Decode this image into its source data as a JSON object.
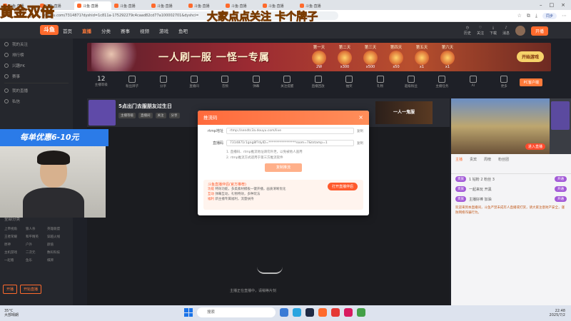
{
  "overlay": {
    "top_left": "黄金双倍",
    "top_center": "大家点点关注 卡个牌子",
    "cam_banner": "每单优惠6-10元"
  },
  "browser": {
    "tabs": [
      "斗鱼·直播",
      "斗鱼·直播",
      "斗鱼·直播",
      "斗鱼·直播",
      "斗鱼·直播",
      "斗鱼·直播",
      "斗鱼·直播",
      "斗鱼·直播",
      "斗鱼·直播"
    ],
    "url": "douyu.com/7314871?dyshid=1c811a-175292279c4caad82cd77a100002701&dyshci=",
    "sync_label": "同步"
  },
  "site": {
    "logo": "斗鱼",
    "nav": [
      "首页",
      "直播",
      "分类",
      "赛事",
      "视频",
      "游戏",
      "鱼吧"
    ],
    "nav_active_index": 1,
    "header_icons": [
      "历史",
      "关注",
      "下载",
      "消息"
    ],
    "open_live": "开播"
  },
  "sidebar": {
    "items": [
      "我的关注",
      "排行榜",
      "兴趣PK",
      "赛事",
      "我的直播",
      "私信"
    ],
    "grid": [
      "上帝视角",
      "狼人杀",
      "英雄联盟",
      "王者荣耀",
      "和平精英",
      "穿越火线",
      "原神",
      "户外",
      "颜值",
      "主机游戏",
      "二次元",
      "数码科技",
      "一起看",
      "鱼乐",
      "棋牌"
    ],
    "section_title": "全部分类",
    "foot_buttons": [
      "开播",
      "开始直播"
    ]
  },
  "banner": {
    "slogan": "一人刷一服  一怪一专属",
    "days": [
      {
        "name": "第一天",
        "value": "2W"
      },
      {
        "name": "第二天",
        "value": "x300"
      },
      {
        "name": "第三天",
        "value": "x500"
      },
      {
        "name": "第四天",
        "value": "x50"
      },
      {
        "name": "第五天",
        "value": "x1"
      },
      {
        "name": "第六天",
        "value": "x1"
      }
    ],
    "play_button": "开始游戏"
  },
  "iconrow": {
    "first_value": "12",
    "items": [
      "主播等级",
      "粉丝牌子",
      "分享",
      "直播间",
      "音频",
      "弹幕",
      "关注提醒",
      "直播回放",
      "抽奖",
      "分享",
      "礼物",
      "超级粉丝",
      "主播任务",
      "AI",
      "更多",
      "表情"
    ],
    "pc_button": "PC客户端"
  },
  "anchor": {
    "title": "5点出门去服朋友过生日",
    "tags": [
      "主播等级",
      "直播间",
      "关注",
      "分享"
    ],
    "promo": "一人一鬼服"
  },
  "video": {
    "loading": "主播正在直播中，请稍等片刻"
  },
  "right_video": {
    "button": "进入直播"
  },
  "right_panel": {
    "tabs": [
      "主播",
      "贵宾",
      "周榜",
      "粉丝团"
    ],
    "lines": [
      {
        "badge": "贵族",
        "text": "1 钻粉 2 粉丝 3",
        "btn": "开通"
      },
      {
        "badge": "贵族",
        "text": "一起来玩 开黑",
        "btn": "开通"
      },
      {
        "badge": "贵族",
        "text": "主播好棒 加油",
        "btn": "开通"
      }
    ],
    "message": "欢迎来到本直播间，斗鱼严禁未成年人直播或打赏，请大家注意财产安全，谨防网络诈骗行为。"
  },
  "modal": {
    "title": "推流码",
    "close": "×",
    "server_label": "rtmp地址",
    "server_value": "rtmp://sendtc3a.douyu.com/live",
    "server_action": "复制",
    "key_label": "直播码",
    "key_value": "7314871r1gng8f?dyID=*****************room=7&tstamp=1",
    "key_action": "复制",
    "note1": "1. 直播码、rtmp推流地址请勿外泄，以免被他人盗用",
    "note2": "2. rtmp推流方式适用于第三方推流软件",
    "cta": "复制推流",
    "promo_title": "斗鱼直播伴侣(官方推荐)",
    "promo_lines": [
      {
        "tag": "功能",
        "text": "特效功能，多类素材模板一键开播，画质清晰优化"
      },
      {
        "tag": "互动",
        "text": "弹幕互动，礼物特效，多种玩法"
      },
      {
        "tag": "福利",
        "text": "新主播专属福利，流量扶持"
      }
    ],
    "promo_button": "打开直播伴侣"
  },
  "taskbar": {
    "weather_temp": "35°C",
    "weather_text": "大部晴朗",
    "search_placeholder": "搜索",
    "time": "22:48",
    "date": "2025/7/2"
  }
}
